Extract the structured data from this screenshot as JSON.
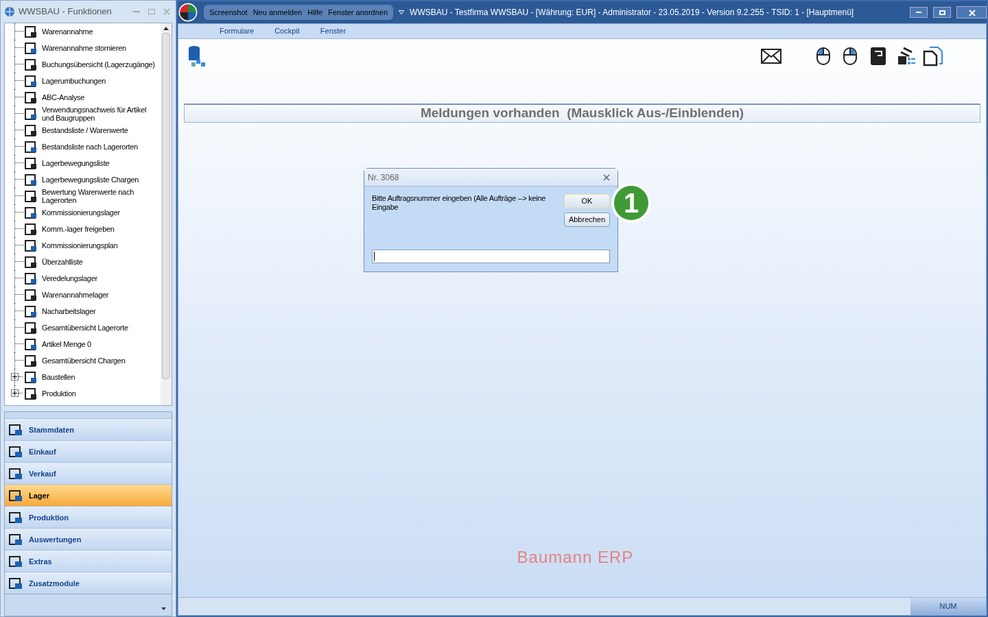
{
  "side_window": {
    "title": "WWSBAU - Funktionen"
  },
  "tree": [
    {
      "label": "Warenannahme",
      "kind": "leaf"
    },
    {
      "label": "Warenannahme stornieren",
      "kind": "leaf"
    },
    {
      "label": "Buchungsübersicht (Lagerzugänge)",
      "kind": "leaf"
    },
    {
      "label": "Lagerumbuchungen",
      "kind": "leaf"
    },
    {
      "label": "ABC-Analyse",
      "kind": "leaf"
    },
    {
      "label": "Verwendungsnachweis für Artikel und Baugruppen",
      "kind": "leaf"
    },
    {
      "label": "Bestandsliste / Warenwerte",
      "kind": "leaf"
    },
    {
      "label": "Bestandsliste nach Lagerorten",
      "kind": "leaf"
    },
    {
      "label": "Lagerbewegungsliste",
      "kind": "leaf"
    },
    {
      "label": "Lagerbewegungsliste Chargen",
      "kind": "leaf"
    },
    {
      "label": "Bewertung Warenwerte nach Lagerorten",
      "kind": "leaf"
    },
    {
      "label": "Kommissionierungslager",
      "kind": "leaf"
    },
    {
      "label": "Komm.-lager freigeben",
      "kind": "leaf"
    },
    {
      "label": "Kommissionierungsplan",
      "kind": "leaf"
    },
    {
      "label": "Überzahlliste",
      "kind": "leaf"
    },
    {
      "label": "Veredelungslager",
      "kind": "leaf"
    },
    {
      "label": "Warenannahmelager",
      "kind": "leaf"
    },
    {
      "label": "Nacharbeitslager",
      "kind": "leaf"
    },
    {
      "label": "Gesamtübersicht Lagerorte",
      "kind": "leaf"
    },
    {
      "label": "Artikel Menge 0",
      "kind": "leaf"
    },
    {
      "label": "Gesamtübersicht Chargen",
      "kind": "leaf"
    },
    {
      "label": "Baustellen",
      "kind": "folder",
      "expanded": false
    },
    {
      "label": "Produktion",
      "kind": "folder",
      "expanded": false
    }
  ],
  "nav": [
    {
      "label": "Stammdaten",
      "selected": false
    },
    {
      "label": "Einkauf",
      "selected": false
    },
    {
      "label": "Verkauf",
      "selected": false
    },
    {
      "label": "Lager",
      "selected": true
    },
    {
      "label": "Produktion",
      "selected": false
    },
    {
      "label": "Auswertungen",
      "selected": false
    },
    {
      "label": "Extras",
      "selected": false
    },
    {
      "label": "Zusatzmodule",
      "selected": false
    }
  ],
  "main_window": {
    "quick_menu": [
      "Screenshot",
      "Neu anmelden",
      "Hilfe",
      "Fenster anordnen"
    ],
    "title": "WWSBAU - Testfirma WWSBAU - [Währung: EUR] - Administrator - 23.05.2019 - Version 9.2.255 - TSID: 1  - [Hauptmenü]"
  },
  "menu": [
    "Formulare",
    "Cockpit",
    "Fenster"
  ],
  "messages_bar": "Meldungen vorhanden  (Mausklick Aus-/Einblenden)",
  "dialog": {
    "title": "Nr. 3068",
    "message": "Bitte Auftragsnummer eingeben (Alle Aufträge --> keine Eingabe",
    "buttons": [
      "OK",
      "Abbrechen"
    ]
  },
  "callout": "1",
  "brand": "Baumann ERP",
  "status_bar": {
    "indicator": "NUM"
  }
}
